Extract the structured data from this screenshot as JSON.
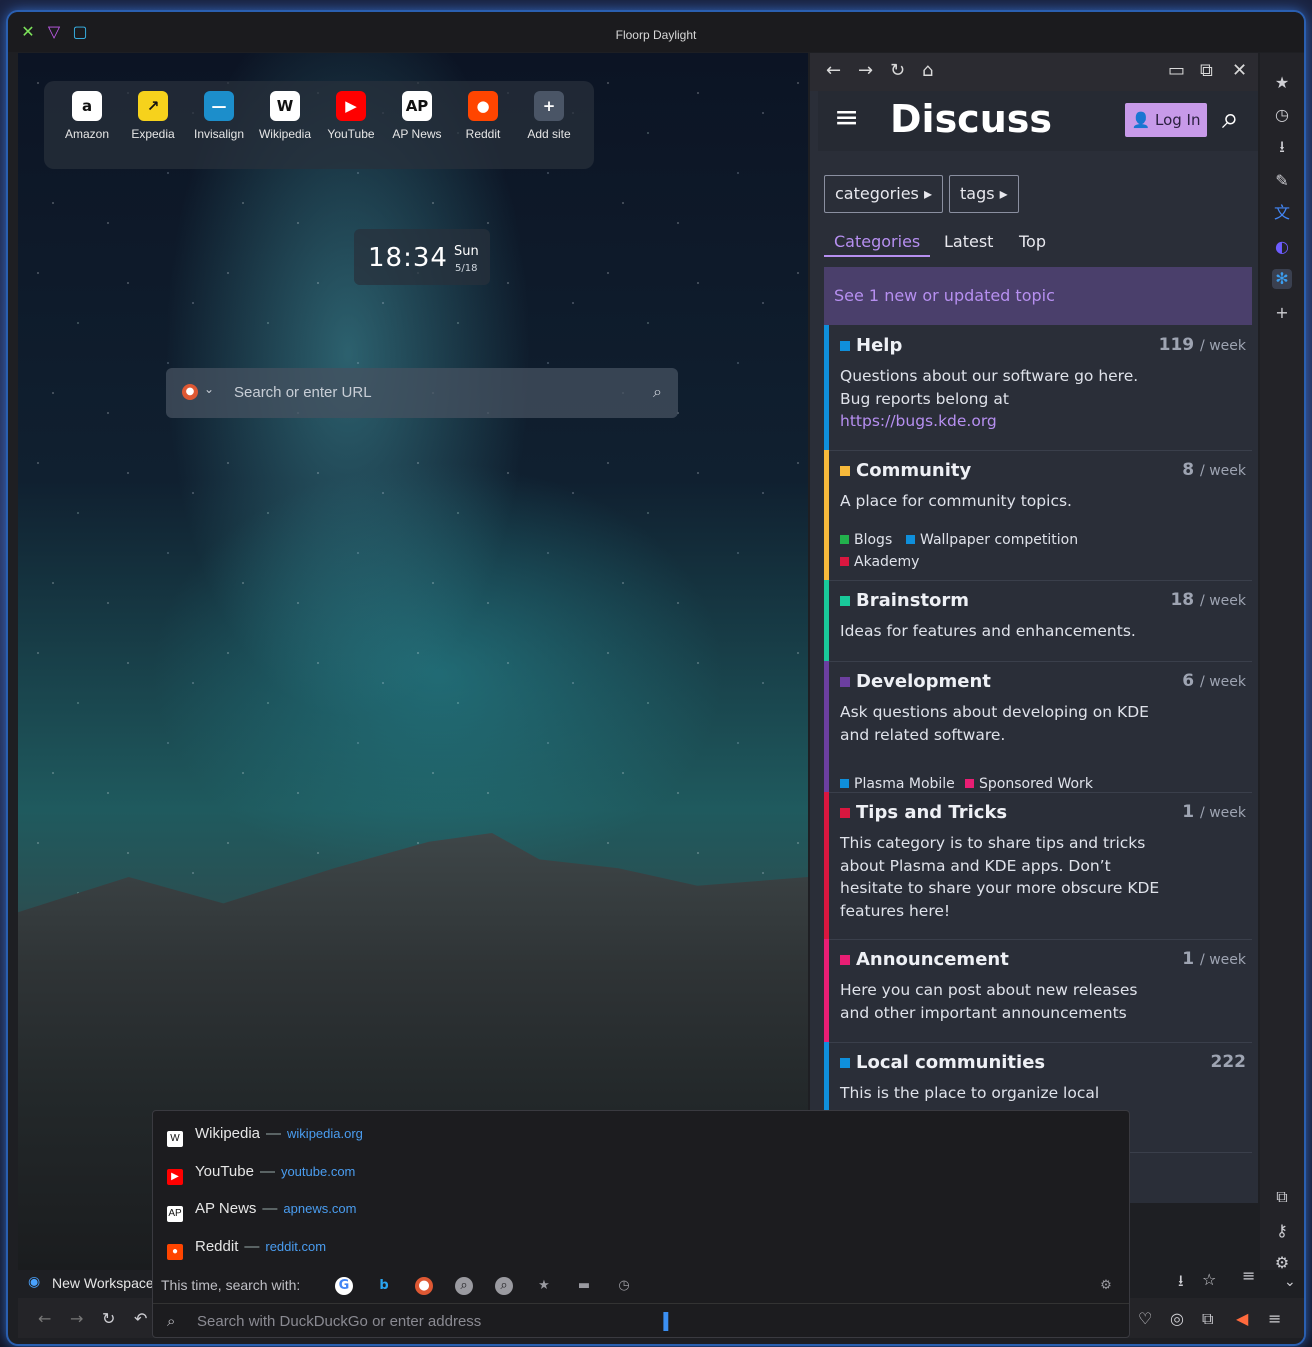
{
  "window": {
    "title": "Floorp Daylight"
  },
  "shortcuts": [
    {
      "label": "Amazon",
      "glyph": "a",
      "bg": "#ffffff",
      "fg": "#111111"
    },
    {
      "label": "Expedia",
      "glyph": "↗",
      "bg": "#f6d21c",
      "fg": "#111111"
    },
    {
      "label": "Invisalign",
      "glyph": "—",
      "bg": "#1c8ecb",
      "fg": "#ffffff"
    },
    {
      "label": "Wikipedia",
      "glyph": "W",
      "bg": "#ffffff",
      "fg": "#111111"
    },
    {
      "label": "YouTube",
      "glyph": "▶",
      "bg": "#ff0000",
      "fg": "#ffffff"
    },
    {
      "label": "AP News",
      "glyph": "AP",
      "bg": "#ffffff",
      "fg": "#111111"
    },
    {
      "label": "Reddit",
      "glyph": "●",
      "bg": "#ff4500",
      "fg": "#ffffff"
    },
    {
      "label": "Add site",
      "glyph": "+",
      "bg": "#4a5566",
      "fg": "#ffffff"
    }
  ],
  "clock": {
    "time": "18:34",
    "day": "Sun",
    "date": "5/18"
  },
  "newtab_search": {
    "placeholder": "Search or enter URL"
  },
  "discuss": {
    "logo": "Discuss",
    "login": "Log In",
    "pills": [
      "categories",
      "tags"
    ],
    "tabs": [
      "Categories",
      "Latest",
      "Top"
    ],
    "new_topic": "See 1 new or updated topic",
    "week_label": "/ week",
    "categories": [
      {
        "name": "Help",
        "count": "119",
        "color": "#0f8fdb",
        "desc": "Questions about our software go here. Bug reports belong at ",
        "link": "https://bugs.kde.org",
        "subs": []
      },
      {
        "name": "Community",
        "count": "8",
        "color": "#f7b93b",
        "desc": "A place for community topics.",
        "link": "",
        "subs": [
          {
            "name": "Blogs",
            "color": "#22b14c"
          },
          {
            "name": "Wallpaper competition",
            "color": "#0f8fdb"
          },
          {
            "name": "Akademy",
            "color": "#d9173f"
          }
        ]
      },
      {
        "name": "Brainstorm",
        "count": "18",
        "color": "#19c99a",
        "desc": "Ideas for features and enhancements.",
        "link": "",
        "subs": []
      },
      {
        "name": "Development",
        "count": "6",
        "color": "#6c3fa0",
        "desc": "Ask questions about developing on KDE and related software.",
        "link": "",
        "subs": [
          {
            "name": "Plasma Mobile",
            "color": "#0f8fdb"
          },
          {
            "name": "Sponsored Work",
            "color": "#e91e74"
          }
        ]
      },
      {
        "name": "Tips and Tricks",
        "count": "1",
        "color": "#d9173f",
        "desc": "This category is to share tips and tricks about Plasma and KDE apps. Don’t hesitate to share your more obscure KDE features here!",
        "link": "",
        "subs": []
      },
      {
        "name": "Announcement",
        "count": "1",
        "color": "#e91e74",
        "desc": "Here you can post about new releases and other important announcements",
        "link": "",
        "subs": []
      },
      {
        "name": "Local communities",
        "count": "222",
        "color": "#0f8fdb",
        "desc": "This is the place to organize local",
        "link": "",
        "subs": []
      }
    ]
  },
  "suggestions": [
    {
      "title": "Wikipedia",
      "url": "wikipedia.org",
      "glyph": "W",
      "bg": "#ffffff",
      "fg": "#111111"
    },
    {
      "title": "YouTube",
      "url": "youtube.com",
      "glyph": "▶",
      "bg": "#ff0000",
      "fg": "#ffffff"
    },
    {
      "title": "AP News",
      "url": "apnews.com",
      "glyph": "AP",
      "bg": "#ffffff",
      "fg": "#111111"
    },
    {
      "title": "Reddit",
      "url": "reddit.com",
      "glyph": "●",
      "bg": "#ff4500",
      "fg": "#ffffff"
    }
  ],
  "search_with": "This time, search with:",
  "address_placeholder": "Search with DuckDuckGo or enter address",
  "workspace": "New Workspace",
  "icons": {
    "window_controls": [
      "close-icon",
      "minimize-icon",
      "maximize-icon"
    ],
    "engines": [
      "google-icon",
      "bing-icon",
      "duckduckgo-icon",
      "search-engine-icon",
      "search-engine-icon",
      "bookmarks-icon",
      "tabs-icon",
      "history-icon"
    ]
  }
}
